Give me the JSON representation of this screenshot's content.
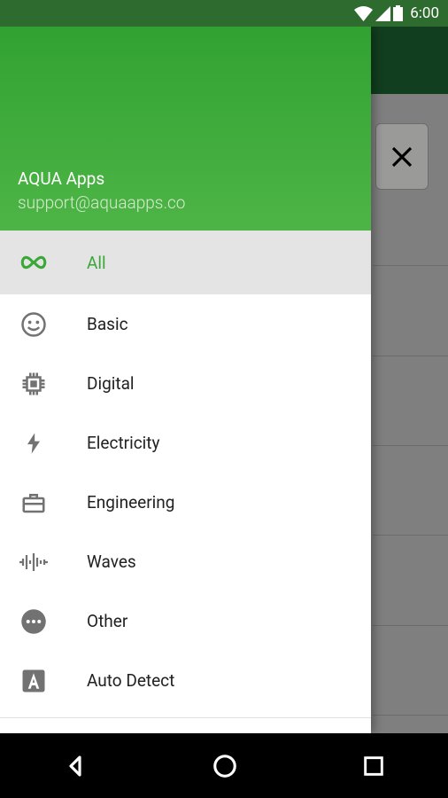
{
  "statusbar": {
    "time": "6:00"
  },
  "drawer": {
    "header": {
      "title": "AQUA Apps",
      "subtitle": "support@aquaapps.co"
    },
    "items": [
      {
        "icon": "infinity-icon",
        "label": "All",
        "selected": true
      },
      {
        "icon": "smiley-icon",
        "label": "Basic",
        "selected": false
      },
      {
        "icon": "chip-icon",
        "label": "Digital",
        "selected": false
      },
      {
        "icon": "bolt-icon",
        "label": "Electricity",
        "selected": false
      },
      {
        "icon": "briefcase-icon",
        "label": "Engineering",
        "selected": false
      },
      {
        "icon": "waves-icon",
        "label": "Waves",
        "selected": false
      },
      {
        "icon": "ellipsis-icon",
        "label": "Other",
        "selected": false
      },
      {
        "icon": "auto-a-icon",
        "label": "Auto Detect",
        "selected": false
      }
    ]
  }
}
